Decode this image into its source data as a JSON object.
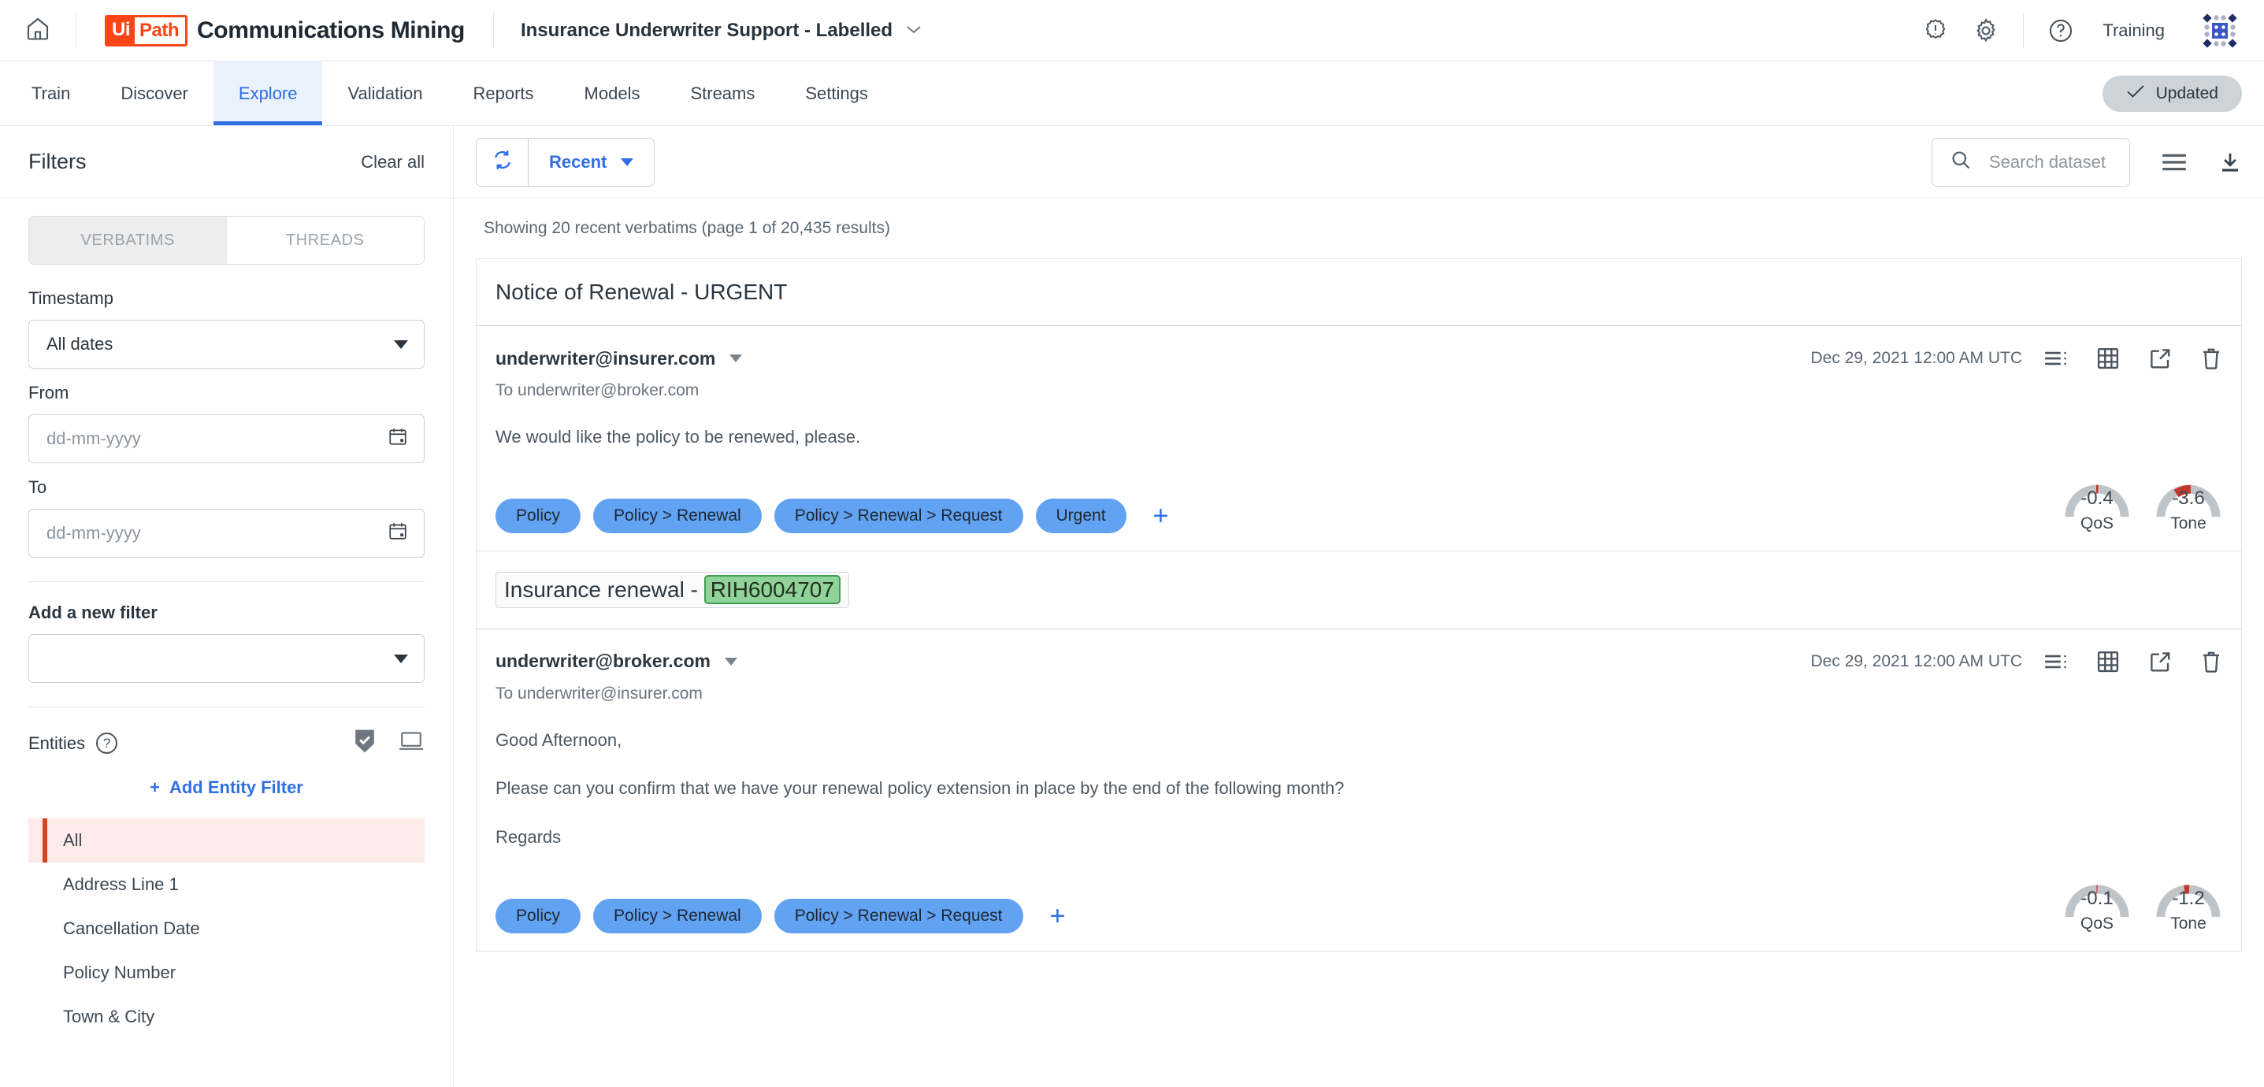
{
  "topbar": {
    "home_icon": "home-icon",
    "logo_ui": "Ui",
    "logo_path": "Path",
    "brand_name": "Communications Mining",
    "project_name": "Insurance Underwriter Support - Labelled",
    "alert_icon": "alert-badge-icon",
    "settings_icon": "gear-icon",
    "help_icon": "help-circle-icon",
    "training_label": "Training",
    "app_switcher_icon": "app-grid-icon"
  },
  "nav": {
    "items": [
      {
        "label": "Train",
        "active": false
      },
      {
        "label": "Discover",
        "active": false
      },
      {
        "label": "Explore",
        "active": true
      },
      {
        "label": "Validation",
        "active": false
      },
      {
        "label": "Reports",
        "active": false
      },
      {
        "label": "Models",
        "active": false
      },
      {
        "label": "Streams",
        "active": false
      },
      {
        "label": "Settings",
        "active": false
      }
    ],
    "status_badge": "Updated",
    "status_icon": "check-icon"
  },
  "sidebar": {
    "title": "Filters",
    "clear_all": "Clear all",
    "segmented": {
      "verbatims": "VERBATIMS",
      "threads": "THREADS",
      "selected": "VERBATIMS"
    },
    "timestamp_label": "Timestamp",
    "timestamp_value": "All dates",
    "from_label": "From",
    "from_placeholder": "dd-mm-yyyy",
    "to_label": "To",
    "to_placeholder": "dd-mm-yyyy",
    "add_filter_label": "Add a new filter",
    "add_filter_value": "",
    "entities_label": "Entities",
    "entities_help_icon": "question-mark-icon",
    "shield_check_icon": "shield-check-icon",
    "laptop_icon": "laptop-icon",
    "add_entity_filter": "Add Entity Filter",
    "add_entity_plus": "+",
    "entity_items": [
      {
        "label": "All",
        "selected": true
      },
      {
        "label": "Address Line 1",
        "selected": false
      },
      {
        "label": "Cancellation Date",
        "selected": false
      },
      {
        "label": "Policy Number",
        "selected": false
      },
      {
        "label": "Town & City",
        "selected": false
      }
    ]
  },
  "toolbar": {
    "refresh_icon": "refresh-icon",
    "sort_label": "Recent",
    "search_icon": "search-icon",
    "search_placeholder": "Search dataset",
    "search_value": "",
    "list_view_icon": "list-view-icon",
    "download_icon": "download-icon"
  },
  "results": {
    "summary": "Showing 20 recent verbatims (page 1 of 20,435 results)",
    "cards": [
      {
        "title": "Notice of Renewal - URGENT",
        "title_boxed": false,
        "title_plain": "Notice of Renewal - URGENT",
        "title_entity": "",
        "sender": "underwriter@insurer.com",
        "timestamp": "Dec 29, 2021 12:00 AM UTC",
        "to_line": "To underwriter@broker.com",
        "paragraphs": [
          "We would like the policy to be renewed, please."
        ],
        "tags": [
          "Policy",
          "Policy > Renewal",
          "Policy > Renewal > Request",
          "Urgent"
        ],
        "add_tag": "+",
        "gauges": [
          {
            "value": "-0.4",
            "label": "QoS",
            "fill_pct": 5,
            "fill_start": 48
          },
          {
            "value": "-3.6",
            "label": "Tone",
            "fill_pct": 17,
            "fill_start": 36
          }
        ],
        "icons": [
          "list-detail-icon",
          "table-view-icon",
          "open-external-icon",
          "trash-icon"
        ]
      },
      {
        "title": "Insurance renewal - RIH6004707",
        "title_boxed": true,
        "title_plain": "Insurance renewal - ",
        "title_entity": "RIH6004707",
        "sender": "underwriter@broker.com",
        "timestamp": "Dec 29, 2021 12:00 AM UTC",
        "to_line": "To underwriter@insurer.com",
        "paragraphs": [
          "Good Afternoon,",
          "Please can you confirm that we have your renewal policy extension in place by the end of the following month?",
          "Regards"
        ],
        "tags": [
          "Policy",
          "Policy > Renewal",
          "Policy > Renewal > Request"
        ],
        "add_tag": "+",
        "gauges": [
          {
            "value": "-0.1",
            "label": "QoS",
            "fill_pct": 3,
            "fill_start": 49
          },
          {
            "value": "-1.2",
            "label": "Tone",
            "fill_pct": 6,
            "fill_start": 44
          }
        ],
        "icons": [
          "list-detail-icon",
          "table-view-icon",
          "open-external-icon",
          "trash-icon"
        ]
      }
    ]
  },
  "colors": {
    "accent_blue": "#2f6fe4",
    "tag_blue": "#62a2f2",
    "brand_orange": "#fa4616",
    "entity_green": "#8fd39a",
    "gauge_red": "#c0392b",
    "selected_red": "#d8431f"
  }
}
